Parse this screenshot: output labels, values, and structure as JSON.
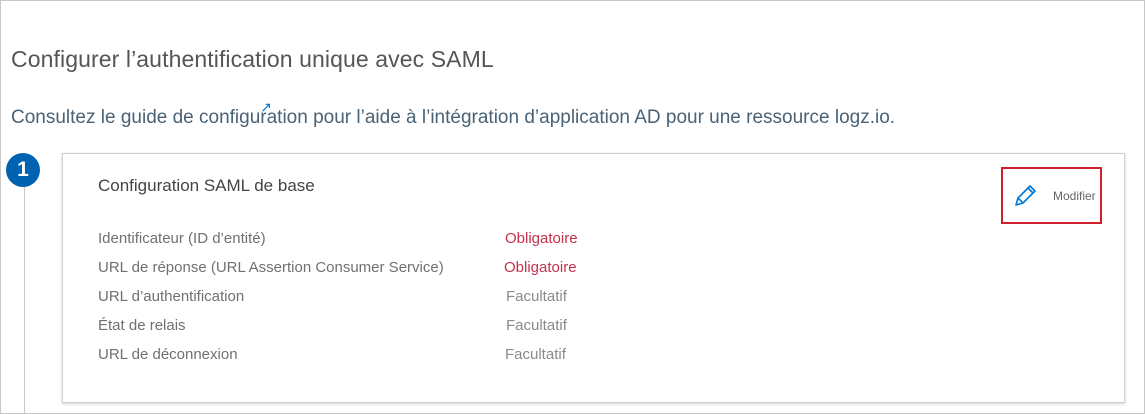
{
  "page": {
    "title": "Configurer l’authentification unique avec SAML",
    "guide": {
      "prefix": "Consultez le guide de ",
      "link_text": "configuration",
      "suffix": " pour l’aide à l’intégration d’application AD pour une ressource logz.io.",
      "link_icon": "external-link-icon"
    }
  },
  "step": {
    "number": "1",
    "card": {
      "title": "Configuration SAML de base",
      "edit_label": "Modifier",
      "edit_icon": "pencil-icon",
      "fields": [
        {
          "label": "Identificateur (ID d’entité)",
          "status": "Obligatoire",
          "required": true
        },
        {
          "label": "URL de réponse (URL Assertion Consumer Service)",
          "status": "Obligatoire",
          "required": true
        },
        {
          "label": "URL d’authentification",
          "status": "Facultatif",
          "required": false
        },
        {
          "label": "État de relais",
          "status": "Facultatif",
          "required": false
        },
        {
          "label": "URL de déconnexion",
          "status": "Facultatif",
          "required": false
        }
      ]
    }
  },
  "colors": {
    "required": "#c4314b",
    "optional": "#8a8a8a",
    "accent": "#0063b1",
    "highlight": "#d0202e"
  }
}
